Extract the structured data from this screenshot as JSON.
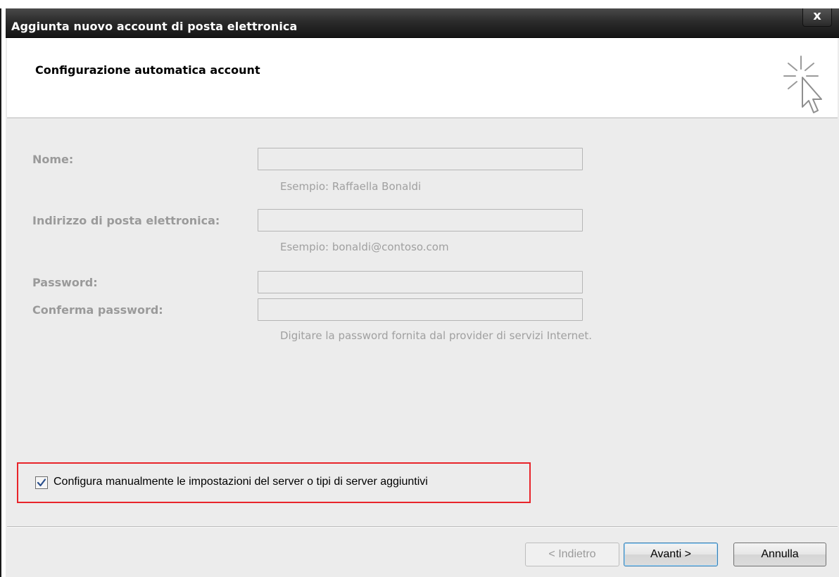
{
  "window": {
    "title": "Aggiunta nuovo account di posta elettronica",
    "close_label": "x"
  },
  "header": {
    "title": "Configurazione automatica account",
    "icon": "cursor-click-icon"
  },
  "form": {
    "name": {
      "label": "Nome:",
      "value": "",
      "hint": "Esempio: Raffaella Bonaldi"
    },
    "email": {
      "label": "Indirizzo di posta elettronica:",
      "value": "",
      "hint": "Esempio: bonaldi@contoso.com"
    },
    "password": {
      "label": "Password:",
      "value": ""
    },
    "confirm_password": {
      "label": "Conferma password:",
      "value": "",
      "hint": "Digitare la password fornita dal provider di servizi Internet."
    }
  },
  "manual_config": {
    "label": "Configura manualmente le impostazioni del server o tipi di server aggiuntivi",
    "checked": true,
    "highlight_color": "#e8242a"
  },
  "buttons": {
    "back": "< Indietro",
    "next": "Avanti >",
    "cancel": "Annulla"
  }
}
